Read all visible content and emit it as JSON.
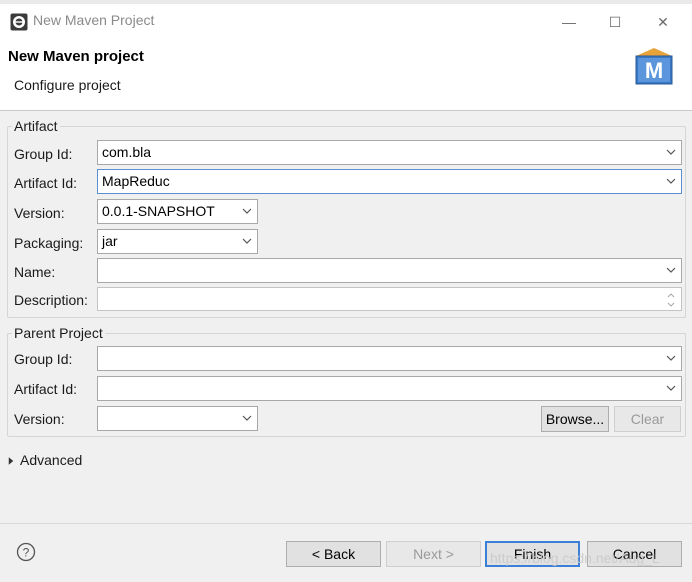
{
  "window": {
    "title": "New Maven Project",
    "controls": {
      "minimize": "—",
      "maximize": "☐",
      "close": "✕"
    }
  },
  "header": {
    "title": "New Maven project",
    "subtitle": "Configure project",
    "logo_letter": "M"
  },
  "artifact": {
    "group_title": "Artifact",
    "group_id": {
      "label": "Group Id:",
      "value": "com.bla"
    },
    "artifact_id": {
      "label": "Artifact Id:",
      "value": "MapReduc"
    },
    "version": {
      "label": "Version:",
      "value": "0.0.1-SNAPSHOT"
    },
    "packaging": {
      "label": "Packaging:",
      "value": "jar"
    },
    "name": {
      "label": "Name:",
      "value": ""
    },
    "description": {
      "label": "Description:",
      "value": ""
    }
  },
  "parent": {
    "group_title": "Parent Project",
    "group_id": {
      "label": "Group Id:",
      "value": ""
    },
    "artifact_id": {
      "label": "Artifact Id:",
      "value": ""
    },
    "version": {
      "label": "Version:",
      "value": ""
    },
    "browse_label": "Browse...",
    "clear_label": "Clear"
  },
  "advanced": {
    "label": "Advanced",
    "expanded": false
  },
  "footer": {
    "help_icon": "?",
    "back_label": "< Back",
    "next_label": "Next >",
    "finish_label": "Finish",
    "cancel_label": "Cancel",
    "watermark": "https://blog.csdn.net/Aug_L"
  },
  "colors": {
    "accent": "#3c7fd6",
    "focus_border": "#5a8fd6",
    "panel_bg": "#f0f0f0",
    "logo_blue": "#3a77c2",
    "logo_orange": "#e8a23a"
  }
}
